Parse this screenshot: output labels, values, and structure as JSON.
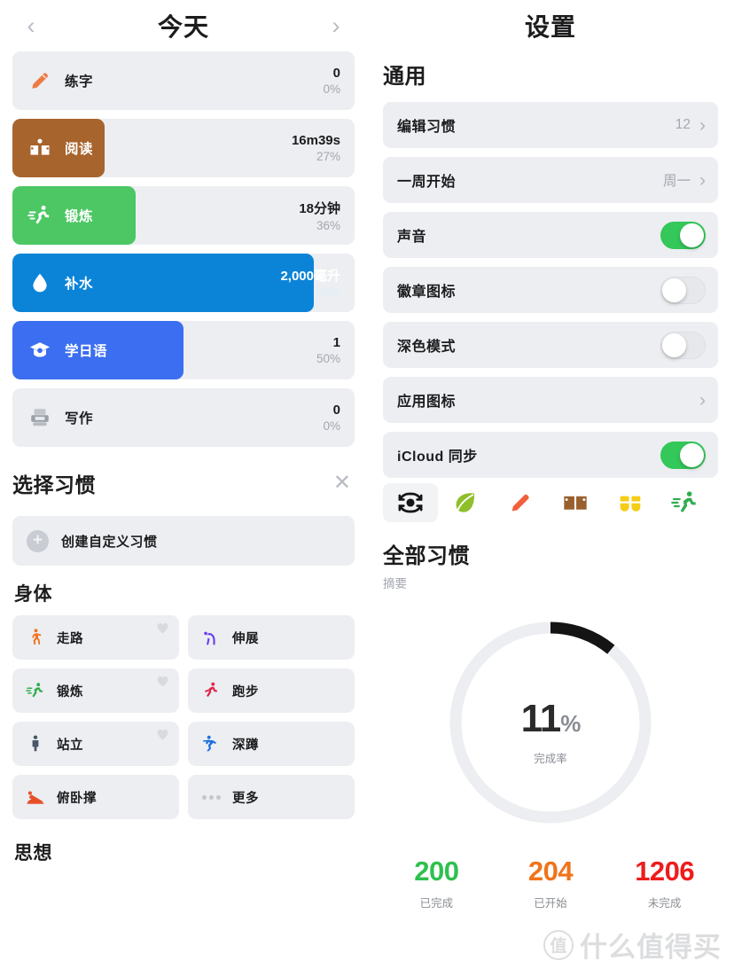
{
  "left": {
    "header": {
      "title": "今天",
      "prev_icon": "chevron-left-icon",
      "next_icon": "chevron-right-icon"
    },
    "habits": [
      {
        "name": "练字",
        "icon": "pencil-icon",
        "value": "0",
        "percent": "0%",
        "fill": 0,
        "color": "#e8764a"
      },
      {
        "name": "阅读",
        "icon": "open-book-icon",
        "value": "16m39s",
        "percent": "27%",
        "fill": 27,
        "color": "#a8642d"
      },
      {
        "name": "锻炼",
        "icon": "running-icon",
        "value": "18分钟",
        "percent": "36%",
        "fill": 36,
        "color": "#4cc764"
      },
      {
        "name": "补水",
        "icon": "water-drop-icon",
        "value": "2,000毫升",
        "percent": "88%",
        "fill": 88,
        "color": "#0b84d8"
      },
      {
        "name": "学日语",
        "icon": "grad-cap-icon",
        "value": "1",
        "percent": "50%",
        "fill": 50,
        "color": "#3b6ef0"
      },
      {
        "name": "写作",
        "icon": "typewriter-icon",
        "value": "0",
        "percent": "0%",
        "fill": 0,
        "color": "#9aa0a8"
      }
    ],
    "sheet": {
      "title": "选择习惯",
      "close_icon": "close-icon",
      "create_label": "创建自定义习惯",
      "create_icon": "plus-circle-icon"
    },
    "categories": [
      {
        "name": "身体",
        "items": [
          {
            "label": "走路",
            "icon": "walking-icon",
            "color": "#f1701f",
            "favorite": true
          },
          {
            "label": "伸展",
            "icon": "stretch-icon",
            "color": "#6a3df0",
            "favorite": false
          },
          {
            "label": "锻炼",
            "icon": "running-icon",
            "color": "#2fad4f",
            "favorite": true
          },
          {
            "label": "跑步",
            "icon": "runner-icon",
            "color": "#e0244a",
            "favorite": false
          },
          {
            "label": "站立",
            "icon": "standing-icon",
            "color": "#4a5568",
            "favorite": true
          },
          {
            "label": "深蹲",
            "icon": "squat-icon",
            "color": "#1a6fe0",
            "favorite": false
          },
          {
            "label": "俯卧撑",
            "icon": "pushup-icon",
            "color": "#e8502a",
            "favorite": false
          },
          {
            "label": "更多",
            "icon": "more-dots-icon",
            "color": "#c3c7cd",
            "favorite": false
          }
        ]
      },
      {
        "name": "思想",
        "items": []
      }
    ]
  },
  "right": {
    "header": {
      "title": "设置"
    },
    "general": {
      "section_title": "通用",
      "rows": [
        {
          "label": "编辑习惯",
          "type": "link",
          "value": "12",
          "chevron": "chevron-right-icon"
        },
        {
          "label": "一周开始",
          "type": "link",
          "value": "周一",
          "chevron": "chevron-right-icon"
        },
        {
          "label": "声音",
          "type": "toggle",
          "on": true
        },
        {
          "label": "徽章图标",
          "type": "toggle",
          "on": false
        },
        {
          "label": "深色模式",
          "type": "toggle",
          "on": false
        },
        {
          "label": "应用图标",
          "type": "link",
          "value": "",
          "chevron": "chevron-right-icon"
        },
        {
          "label": "iCloud 同步",
          "type": "toggle",
          "on": true
        }
      ]
    },
    "icon_strip": [
      {
        "icon": "target-face-icon",
        "color": "#151515",
        "selected": true
      },
      {
        "icon": "leaf-icon",
        "color": "#8fbf2a",
        "selected": false
      },
      {
        "icon": "pencil-icon",
        "color": "#f2603c",
        "selected": false
      },
      {
        "icon": "open-book-icon",
        "color": "#9a5f2e",
        "selected": false
      },
      {
        "icon": "teeth-icon",
        "color": "#f5cc17",
        "selected": false
      },
      {
        "icon": "running-icon",
        "color": "#2fad4f",
        "selected": false
      }
    ],
    "all_habits": {
      "title": "全部习惯",
      "subtitle": "摘要",
      "ring": {
        "percent_value": "11",
        "percent_symbol": "%",
        "label": "完成率",
        "progress": 11,
        "arc_color": "#141414",
        "track_color": "#eceef1"
      },
      "stats": [
        {
          "number": "200",
          "caption": "已完成",
          "color": "#2fc14e"
        },
        {
          "number": "204",
          "caption": "已开始",
          "color": "#f0741a"
        },
        {
          "number": "1206",
          "caption": "未完成",
          "color": "#ee1c1c"
        }
      ]
    }
  },
  "watermark": {
    "mark": "值",
    "text": "什么值得买"
  }
}
